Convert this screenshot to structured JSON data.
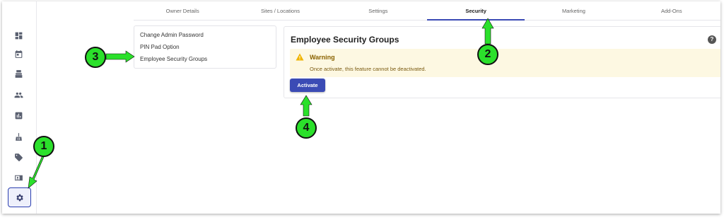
{
  "tabs": [
    {
      "label": "Owner Details"
    },
    {
      "label": "Sites / Locations"
    },
    {
      "label": "Settings"
    },
    {
      "label": "Security"
    },
    {
      "label": "Marketing"
    },
    {
      "label": "Add-Ons"
    }
  ],
  "active_tab": "Security",
  "submenu": {
    "items": [
      {
        "label": "Change Admin Password"
      },
      {
        "label": "PIN Pad Option"
      },
      {
        "label": "Employee Security Groups"
      }
    ]
  },
  "panel": {
    "title": "Employee Security Groups",
    "help_label": "?",
    "warning": {
      "title": "Warning",
      "text": "Once activate, this feature cannot be deactivated."
    },
    "activate_label": "Activate"
  },
  "sidebar": {
    "icons": [
      "dashboard-icon",
      "calendar-icon",
      "register-icon",
      "people-icon",
      "reports-icon",
      "cleaning-icon",
      "tag-icon",
      "id-card-icon",
      "settings-icon"
    ]
  },
  "callouts": {
    "one": "1",
    "two": "2",
    "three": "3",
    "four": "4"
  },
  "colors": {
    "accent": "#3b4bb5",
    "callout": "#2be02b",
    "warning_bg": "#fdf8e2"
  }
}
